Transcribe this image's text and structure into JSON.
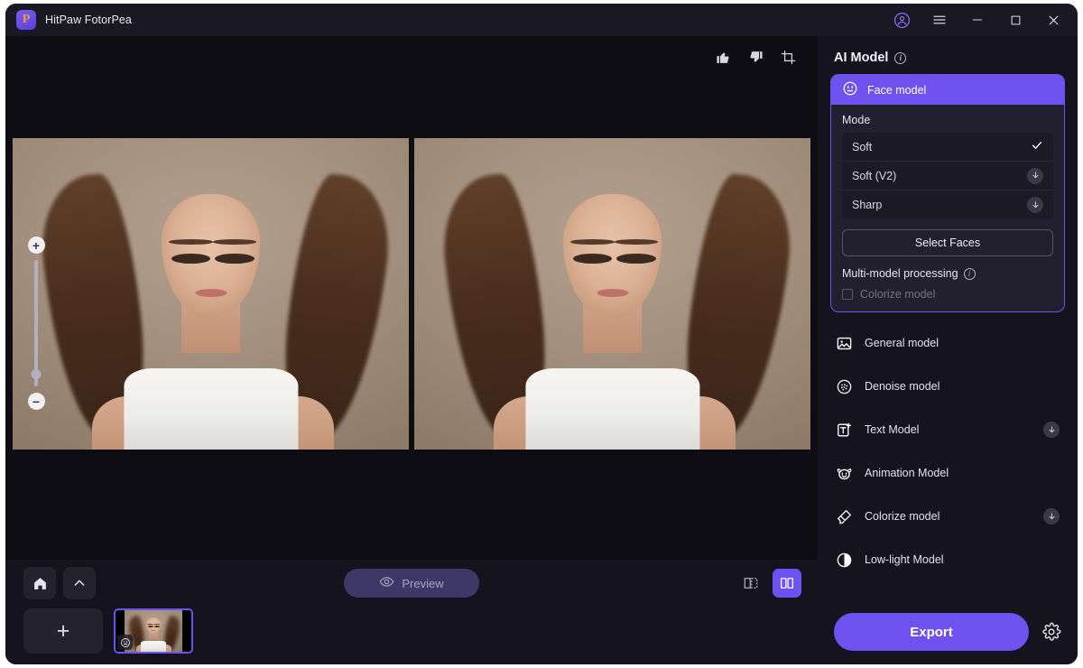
{
  "window": {
    "app_title": "HitPaw FotorPea",
    "logo_glyph": "P",
    "controls": {
      "account": "account-icon",
      "menu": "hamburger-menu-icon",
      "minimize": "minimize-icon",
      "maximize": "maximize-icon",
      "close": "close-icon"
    }
  },
  "canvas": {
    "tools": [
      {
        "name": "thumbs-up-icon",
        "label": "Like"
      },
      {
        "name": "thumbs-down-icon",
        "label": "Dislike"
      },
      {
        "name": "crop-icon",
        "label": "Crop"
      }
    ],
    "zoom": {
      "plus": "+",
      "minus": "−"
    },
    "panes": [
      "original",
      "enhanced"
    ]
  },
  "bottom_bar": {
    "home_label": "Home",
    "collapse_label": "Collapse",
    "add_label": "+",
    "preview_label": "Preview",
    "preview_enabled": false,
    "view_modes": [
      {
        "name": "split-view-icon",
        "label": "Split view",
        "active": false
      },
      {
        "name": "side-by-side-view-icon",
        "label": "Side by side view",
        "active": true
      }
    ],
    "thumbnail_badge": "face-model-badge-icon"
  },
  "panel": {
    "title": "AI Model",
    "title_info": "info-icon",
    "face_card": {
      "header_label": "Face model",
      "header_icon": "face-model-icon",
      "mode_label": "Mode",
      "modes": [
        {
          "label": "Soft",
          "state": "selected",
          "trailing": "check"
        },
        {
          "label": "Soft (V2)",
          "state": "downloadable",
          "trailing": "download"
        },
        {
          "label": "Sharp",
          "state": "downloadable",
          "trailing": "download"
        }
      ],
      "select_faces_label": "Select Faces",
      "multi_model_label": "Multi-model processing",
      "multi_model_info": "info-icon",
      "colorize_checkbox_label": "Colorize model",
      "colorize_checked": false,
      "colorize_disabled": true
    },
    "models": [
      {
        "label": "General model",
        "icon": "image-model-icon",
        "download": false
      },
      {
        "label": "Denoise model",
        "icon": "denoise-model-icon",
        "download": false
      },
      {
        "label": "Text Model",
        "icon": "text-model-icon",
        "download": true
      },
      {
        "label": "Animation Model",
        "icon": "animation-model-icon",
        "download": false
      },
      {
        "label": "Colorize model",
        "icon": "colorize-model-icon",
        "download": true
      },
      {
        "label": "Low-light Model",
        "icon": "lowlight-model-icon",
        "download": false
      }
    ],
    "export_label": "Export",
    "settings_icon": "gear-icon"
  },
  "colors": {
    "accent": "#6d52f0",
    "accent_muted": "#3e3869",
    "panel_bg": "#15131d",
    "canvas_bg": "#0e0d13",
    "card_bg": "#22202e"
  }
}
